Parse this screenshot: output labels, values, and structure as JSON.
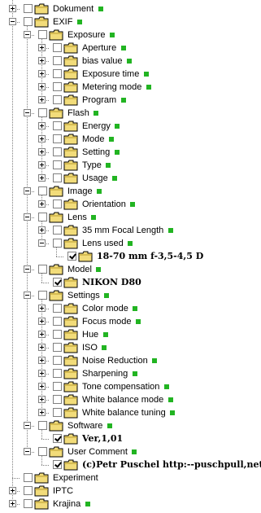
{
  "accent_color": "#22b422",
  "icons": {
    "expander": "tree-expander-icon",
    "checkbox": "checkbox-icon",
    "folder": "folder-icon",
    "status": "status-dot-icon"
  },
  "tree": [
    {
      "level": 1,
      "label": "Dokument",
      "expander": "plus",
      "checked": false,
      "dot": true,
      "value": false
    },
    {
      "level": 1,
      "label": "EXIF",
      "expander": "minus",
      "checked": false,
      "dot": true,
      "value": false
    },
    {
      "level": 2,
      "label": "Exposure",
      "expander": "minus",
      "checked": false,
      "dot": true,
      "value": false
    },
    {
      "level": 3,
      "label": "Aperture",
      "expander": "plus",
      "checked": false,
      "dot": true,
      "value": false
    },
    {
      "level": 3,
      "label": "bias value",
      "expander": "plus",
      "checked": false,
      "dot": true,
      "value": false
    },
    {
      "level": 3,
      "label": "Exposure time",
      "expander": "plus",
      "checked": false,
      "dot": true,
      "value": false
    },
    {
      "level": 3,
      "label": "Metering mode",
      "expander": "plus",
      "checked": false,
      "dot": true,
      "value": false
    },
    {
      "level": 3,
      "label": "Program",
      "expander": "plus",
      "checked": false,
      "dot": true,
      "value": false
    },
    {
      "level": 2,
      "label": "Flash",
      "expander": "minus",
      "checked": false,
      "dot": true,
      "value": false
    },
    {
      "level": 3,
      "label": "Energy",
      "expander": "plus",
      "checked": false,
      "dot": true,
      "value": false
    },
    {
      "level": 3,
      "label": "Mode",
      "expander": "plus",
      "checked": false,
      "dot": true,
      "value": false
    },
    {
      "level": 3,
      "label": "Setting",
      "expander": "plus",
      "checked": false,
      "dot": true,
      "value": false
    },
    {
      "level": 3,
      "label": "Type",
      "expander": "plus",
      "checked": false,
      "dot": true,
      "value": false
    },
    {
      "level": 3,
      "label": "Usage",
      "expander": "plus",
      "checked": false,
      "dot": true,
      "value": false
    },
    {
      "level": 2,
      "label": "Image",
      "expander": "minus",
      "checked": false,
      "dot": true,
      "value": false
    },
    {
      "level": 3,
      "label": "Orientation",
      "expander": "plus",
      "checked": false,
      "dot": true,
      "value": false
    },
    {
      "level": 2,
      "label": "Lens",
      "expander": "minus",
      "checked": false,
      "dot": true,
      "value": false
    },
    {
      "level": 3,
      "label": "35 mm Focal Length",
      "expander": "plus",
      "checked": false,
      "dot": true,
      "value": false
    },
    {
      "level": 3,
      "label": "Lens used",
      "expander": "minus",
      "checked": false,
      "dot": true,
      "value": false
    },
    {
      "level": 4,
      "label": "18-70 mm f-3,5-4,5 D",
      "expander": "none",
      "checked": true,
      "dot": false,
      "value": true
    },
    {
      "level": 2,
      "label": "Model",
      "expander": "minus",
      "checked": false,
      "dot": true,
      "value": false
    },
    {
      "level": 3,
      "label": "NIKON D80",
      "expander": "none",
      "checked": true,
      "dot": false,
      "value": true
    },
    {
      "level": 2,
      "label": "Settings",
      "expander": "minus",
      "checked": false,
      "dot": true,
      "value": false
    },
    {
      "level": 3,
      "label": "Color mode",
      "expander": "plus",
      "checked": false,
      "dot": true,
      "value": false
    },
    {
      "level": 3,
      "label": "Focus mode",
      "expander": "plus",
      "checked": false,
      "dot": true,
      "value": false
    },
    {
      "level": 3,
      "label": "Hue",
      "expander": "plus",
      "checked": false,
      "dot": true,
      "value": false
    },
    {
      "level": 3,
      "label": "ISO",
      "expander": "plus",
      "checked": false,
      "dot": true,
      "value": false
    },
    {
      "level": 3,
      "label": "Noise Reduction",
      "expander": "plus",
      "checked": false,
      "dot": true,
      "value": false
    },
    {
      "level": 3,
      "label": "Sharpening",
      "expander": "plus",
      "checked": false,
      "dot": true,
      "value": false
    },
    {
      "level": 3,
      "label": "Tone compensation",
      "expander": "plus",
      "checked": false,
      "dot": true,
      "value": false
    },
    {
      "level": 3,
      "label": "White balance mode",
      "expander": "plus",
      "checked": false,
      "dot": true,
      "value": false
    },
    {
      "level": 3,
      "label": "White balance tuning",
      "expander": "plus",
      "checked": false,
      "dot": true,
      "value": false
    },
    {
      "level": 2,
      "label": "Software",
      "expander": "minus",
      "checked": false,
      "dot": true,
      "value": false
    },
    {
      "level": 3,
      "label": "Ver,1,01",
      "expander": "none",
      "checked": true,
      "dot": false,
      "value": true
    },
    {
      "level": 2,
      "label": "User Comment",
      "expander": "minus",
      "checked": false,
      "dot": true,
      "value": false
    },
    {
      "level": 3,
      "label": "(c)Petr Puschel http:--puschpull,net",
      "expander": "none",
      "checked": true,
      "dot": false,
      "value": true
    },
    {
      "level": 1,
      "label": "Experiment",
      "expander": "none",
      "checked": false,
      "dot": false,
      "value": false
    },
    {
      "level": 1,
      "label": "IPTC",
      "expander": "plus",
      "checked": false,
      "dot": false,
      "value": false
    },
    {
      "level": 1,
      "label": "Krajina",
      "expander": "plus",
      "checked": false,
      "dot": true,
      "value": false
    }
  ]
}
